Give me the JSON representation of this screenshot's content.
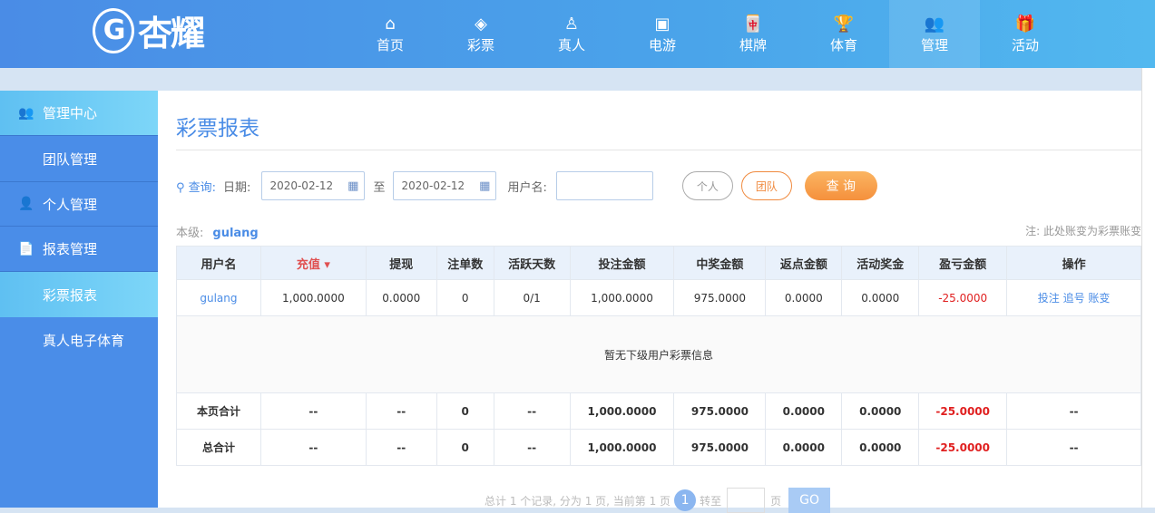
{
  "brand": {
    "logo_text": "杏耀"
  },
  "nav": [
    {
      "label": "首页",
      "icon": "home-icon"
    },
    {
      "label": "彩票",
      "icon": "lottery-icon"
    },
    {
      "label": "真人",
      "icon": "live-icon"
    },
    {
      "label": "电游",
      "icon": "slot-icon"
    },
    {
      "label": "棋牌",
      "icon": "cards-icon"
    },
    {
      "label": "体育",
      "icon": "trophy-icon"
    },
    {
      "label": "管理",
      "icon": "users-icon",
      "active": true
    },
    {
      "label": "活动",
      "icon": "gift-icon"
    }
  ],
  "sidebar": {
    "items": [
      {
        "label": "管理中心"
      },
      {
        "label": "团队管理"
      },
      {
        "label": "个人管理"
      },
      {
        "label": "报表管理"
      },
      {
        "label": "彩票报表"
      },
      {
        "label": "真人电子体育"
      }
    ]
  },
  "page": {
    "title": "彩票报表"
  },
  "query": {
    "label": "查询:",
    "date_label": "日期:",
    "start": "2020-02-12",
    "to": "至",
    "end": "2020-02-12",
    "user_label": "用户名:",
    "user_value": "",
    "personal": "个人",
    "team": "团队",
    "search": "查 询"
  },
  "level": {
    "label": "本级:",
    "user": "gulang"
  },
  "note": "注: 此处账变为彩票账变",
  "table": {
    "headers": [
      "用户名",
      "充值",
      "提现",
      "注单数",
      "活跃天数",
      "投注金额",
      "中奖金额",
      "返点金额",
      "活动奖金",
      "盈亏金额",
      "操作"
    ],
    "row": [
      "gulang",
      "1,000.0000",
      "0.0000",
      "0",
      "0/1",
      "1,000.0000",
      "975.0000",
      "0.0000",
      "0.0000",
      "-25.0000"
    ],
    "actions": [
      "投注",
      "追号",
      "账变"
    ],
    "empty": "暂无下级用户彩票信息",
    "page_total": [
      "本页合计",
      "--",
      "--",
      "0",
      "--",
      "1,000.0000",
      "975.0000",
      "0.0000",
      "0.0000",
      "-25.0000",
      "--"
    ],
    "grand_total": [
      "总合计",
      "--",
      "--",
      "0",
      "--",
      "1,000.0000",
      "975.0000",
      "0.0000",
      "0.0000",
      "-25.0000",
      "--"
    ]
  },
  "pager": {
    "summary": "总计 1 个记录, 分为 1 页, 当前第 1 页",
    "current": "1",
    "goto": "转至",
    "page": "页",
    "go": "GO"
  },
  "colors": {
    "accent": "#4a8ce6",
    "negative": "#e02020",
    "search_button": "#f7a04a"
  }
}
